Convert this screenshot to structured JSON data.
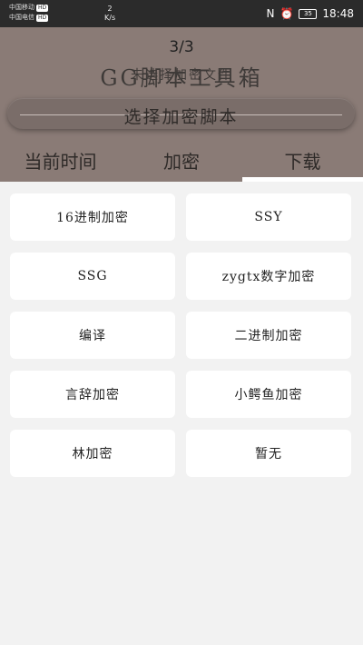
{
  "status_bar": {
    "carrier1": "中国移动",
    "carrier2": "中国电信",
    "badge": "HD",
    "network_top": "2",
    "network_unit": "K/s",
    "battery": "35",
    "time": "18:48"
  },
  "header": {
    "page_indicator": "3/3",
    "title": "GG脚本工具箱",
    "subtitle": "未选择加密文件",
    "select_button": "选择加密脚本"
  },
  "tabs": [
    "当前时间",
    "加密",
    "下载"
  ],
  "active_tab": 2,
  "colors": {
    "header_bg": "#8a7b76",
    "button_bg": "#7a6d69",
    "page_bg": "#f2f2f2"
  },
  "options": [
    "16进制加密",
    "SSY",
    "SSG",
    "zygtx数字加密",
    "编译",
    "二进制加密",
    "言辞加密",
    "小鳄鱼加密",
    "林加密",
    "暂无"
  ]
}
